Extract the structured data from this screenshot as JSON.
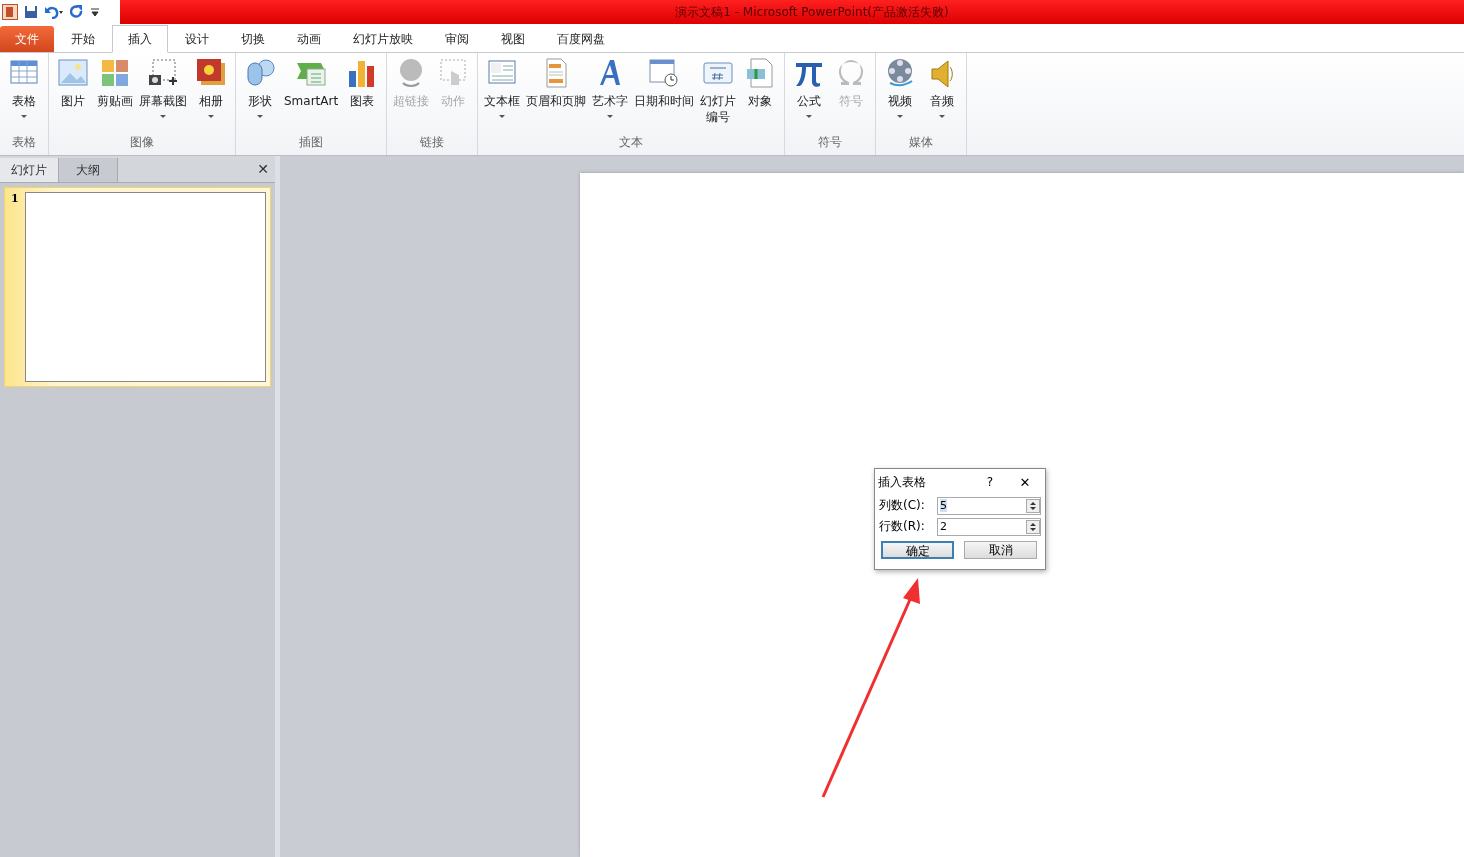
{
  "title_bar": {
    "title": "演示文稿1 - Microsoft PowerPoint(产品激活失败)"
  },
  "tabs": [
    {
      "label": "文件",
      "kind": "file",
      "selected": false
    },
    {
      "label": "开始",
      "kind": "tab",
      "selected": false
    },
    {
      "label": "插入",
      "kind": "tab",
      "selected": true
    },
    {
      "label": "设计",
      "kind": "tab",
      "selected": false
    },
    {
      "label": "切换",
      "kind": "tab",
      "selected": false
    },
    {
      "label": "动画",
      "kind": "tab",
      "selected": false
    },
    {
      "label": "幻灯片放映",
      "kind": "tab",
      "selected": false
    },
    {
      "label": "审阅",
      "kind": "tab",
      "selected": false
    },
    {
      "label": "视图",
      "kind": "tab",
      "selected": false
    },
    {
      "label": "百度网盘",
      "kind": "tab",
      "selected": false
    }
  ],
  "ribbon_groups": [
    {
      "label": "表格",
      "buttons": [
        {
          "label": "表格",
          "dropdown": true,
          "disabled": false
        }
      ]
    },
    {
      "label": "图像",
      "buttons": [
        {
          "label": "图片",
          "dropdown": false,
          "disabled": false
        },
        {
          "label": "剪贴画",
          "dropdown": false,
          "disabled": false
        },
        {
          "label": "屏幕截图",
          "dropdown": true,
          "disabled": false
        },
        {
          "label": "相册",
          "dropdown": true,
          "disabled": false
        }
      ]
    },
    {
      "label": "插图",
      "buttons": [
        {
          "label": "形状",
          "dropdown": true,
          "disabled": false
        },
        {
          "label": "SmartArt",
          "dropdown": false,
          "disabled": false
        },
        {
          "label": "图表",
          "dropdown": false,
          "disabled": false
        }
      ]
    },
    {
      "label": "链接",
      "buttons": [
        {
          "label": "超链接",
          "dropdown": false,
          "disabled": true
        },
        {
          "label": "动作",
          "dropdown": false,
          "disabled": true
        }
      ]
    },
    {
      "label": "文本",
      "buttons": [
        {
          "label": "文本框",
          "dropdown": true,
          "disabled": false
        },
        {
          "label": "页眉和页脚",
          "dropdown": false,
          "disabled": false
        },
        {
          "label": "艺术字",
          "dropdown": true,
          "disabled": false
        },
        {
          "label": "日期和时间",
          "dropdown": false,
          "disabled": false
        },
        {
          "label": "幻灯片",
          "label_line_2": "编号",
          "dropdown": false,
          "disabled": false
        },
        {
          "label": "对象",
          "dropdown": false,
          "disabled": false
        }
      ]
    },
    {
      "label": "符号",
      "buttons": [
        {
          "label": "公式",
          "dropdown": true,
          "disabled": false
        },
        {
          "label": "符号",
          "dropdown": false,
          "disabled": true
        }
      ]
    },
    {
      "label": "媒体",
      "buttons": [
        {
          "label": "视频",
          "dropdown": true,
          "disabled": false
        },
        {
          "label": "音频",
          "dropdown": true,
          "disabled": false
        }
      ]
    }
  ],
  "slide_pane": {
    "tabs": [
      {
        "label": "幻灯片",
        "selected": true
      },
      {
        "label": "大纲",
        "selected": false
      }
    ],
    "close": "✕",
    "slides": [
      {
        "number": "1",
        "selected": true
      }
    ]
  },
  "dialog": {
    "title": "插入表格",
    "help": "?",
    "close": "✕",
    "fields": [
      {
        "label": "列数(C):",
        "value": "5",
        "selected": true
      },
      {
        "label": "行数(R):",
        "value": "2",
        "selected": false
      }
    ],
    "buttons": [
      {
        "label": "确定",
        "selected": true
      },
      {
        "label": "取消",
        "selected": false
      }
    ]
  }
}
